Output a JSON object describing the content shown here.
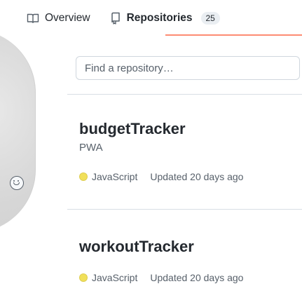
{
  "tabs": [
    {
      "label": "Overview",
      "icon": "book-icon",
      "active": false
    },
    {
      "label": "Repositories",
      "icon": "repo-icon",
      "active": true,
      "count": "25"
    }
  ],
  "search": {
    "placeholder": "Find a repository…"
  },
  "repositories": [
    {
      "name": "budgetTracker",
      "description": "PWA",
      "language": "JavaScript",
      "language_color": "#f1e05a",
      "updated": "Updated 20 days ago"
    },
    {
      "name": "workoutTracker",
      "description": "",
      "language": "JavaScript",
      "language_color": "#f1e05a",
      "updated": "Updated 20 days ago"
    }
  ],
  "sidebar": {
    "status_icon": "smiley-icon"
  },
  "colors": {
    "active_tab_underline": "#fd8c73",
    "counter_bg": "#eaeef2",
    "text_primary": "#24292f",
    "text_secondary": "#57606a"
  }
}
